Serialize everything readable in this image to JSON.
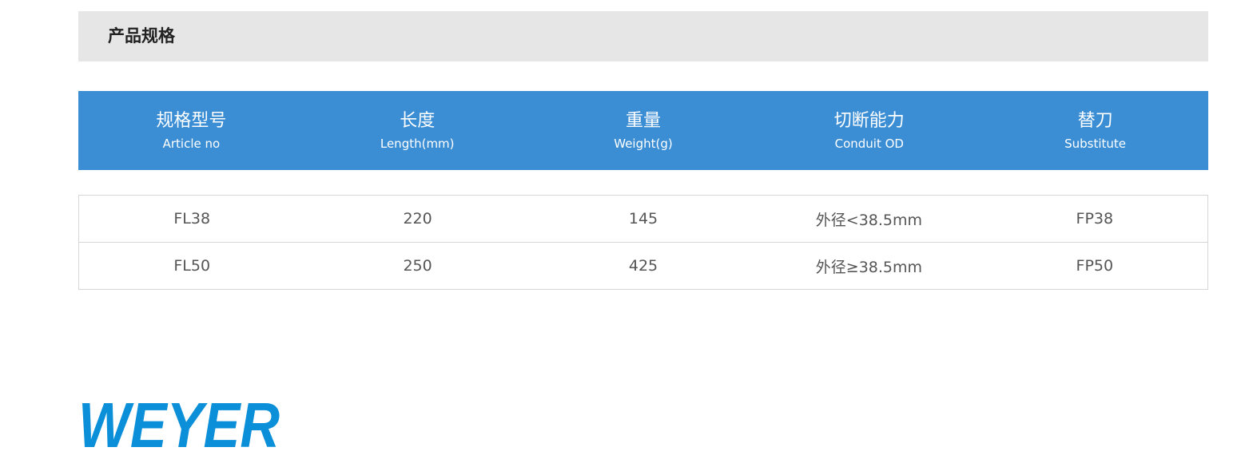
{
  "section": {
    "title": "产品规格"
  },
  "table": {
    "columns": [
      {
        "zh": "规格型号",
        "en": "Article no"
      },
      {
        "zh": "长度",
        "en": "Length(mm)"
      },
      {
        "zh": "重量",
        "en": "Weight(g)"
      },
      {
        "zh": "切断能力",
        "en": "Conduit OD"
      },
      {
        "zh": "替刀",
        "en": "Substitute"
      }
    ],
    "rows": [
      [
        "FL38",
        "220",
        "145",
        "外径<38.5mm",
        "FP38"
      ],
      [
        "FL50",
        "250",
        "425",
        "外径≥38.5mm",
        "FP50"
      ]
    ]
  },
  "logo": {
    "text": "WEYER",
    "color": "#0a8fd8"
  },
  "colors": {
    "header_bg": "#e6e6e6",
    "table_head_bg": "#3c8ed4",
    "border": "#d6d6d6"
  }
}
